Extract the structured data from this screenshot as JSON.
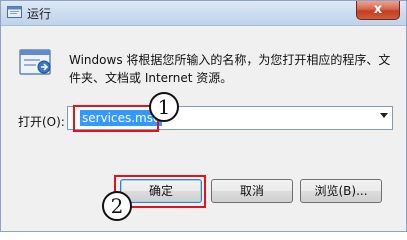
{
  "window": {
    "title": "运行",
    "close_glyph": "x"
  },
  "dialog": {
    "description": "Windows 将根据您所输入的名称，为您打开相应的程序、文件夹、文档或 Internet 资源。",
    "open_label": "打开(O):",
    "open_value": "services.msc"
  },
  "buttons": {
    "ok": "确定",
    "cancel": "取消",
    "browse": "浏览(B)..."
  },
  "annotations": {
    "step1": "1",
    "step2": "2",
    "highlight_color": "#e0141e"
  },
  "icons": {
    "title": "run-app-icon",
    "main": "run-program-icon",
    "dropdown": "chevron-down-icon"
  }
}
